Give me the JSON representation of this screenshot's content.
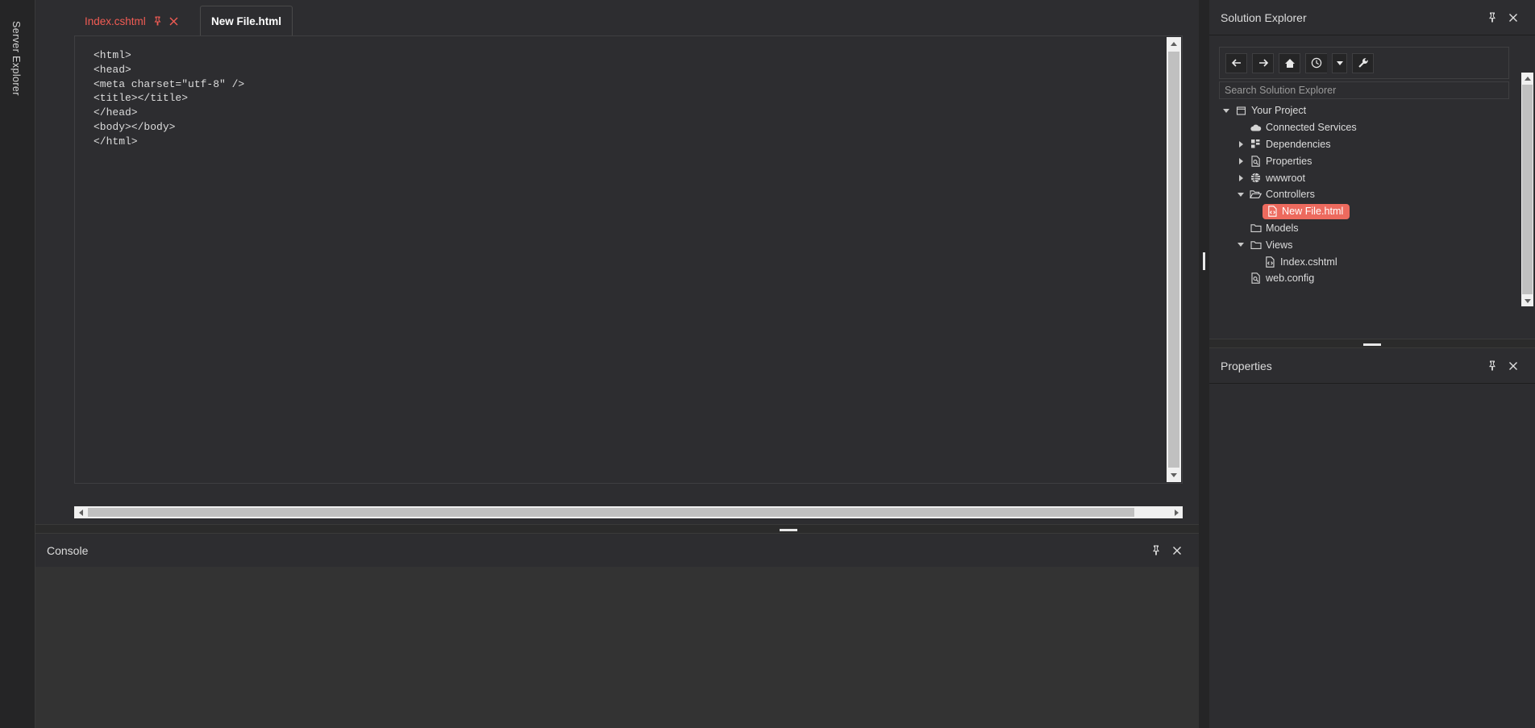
{
  "left_dock": {
    "label": "Server Explorer"
  },
  "editor": {
    "tabs": [
      {
        "title": "Index.cshtml",
        "active": false,
        "pin_icon": "pin-icon",
        "close_icon": "close-icon"
      },
      {
        "title": "New File.html",
        "active": true
      }
    ],
    "code": "<html>\n<head>\n<meta charset=\"utf-8\" />\n<title></title>\n</head>\n<body></body>\n</html>",
    "code_color": "#dcdcdc"
  },
  "solution_explorer": {
    "title": "Solution Explorer",
    "pin_label": "pin-icon",
    "close_label": "close-icon",
    "toolbar": [
      {
        "name": "back-button",
        "icon": "arrow-left-icon"
      },
      {
        "name": "forward-button",
        "icon": "arrow-right-icon"
      },
      {
        "name": "home-button",
        "icon": "home-icon"
      },
      {
        "name": "pending-changes-button",
        "icon": "clock-icon"
      },
      {
        "name": "pending-changes-dropdown",
        "icon": "chevron-down-icon"
      },
      {
        "name": "properties-button",
        "icon": "wrench-icon"
      }
    ],
    "search": {
      "placeholder": "Search Solution Explorer",
      "value": ""
    },
    "tree": [
      {
        "label": "Your Project",
        "depth": 0,
        "twisty": "down",
        "icon": "solution-icon",
        "selected": false
      },
      {
        "label": "Connected Services",
        "depth": 1,
        "twisty": "none",
        "icon": "cloud-icon",
        "selected": false
      },
      {
        "label": "Dependencies",
        "depth": 1,
        "twisty": "right",
        "icon": "packages-icon",
        "selected": false
      },
      {
        "label": "Properties",
        "depth": 1,
        "twisty": "right",
        "icon": "config-icon",
        "selected": false
      },
      {
        "label": "wwwroot",
        "depth": 1,
        "twisty": "right",
        "icon": "globe-icon",
        "selected": false
      },
      {
        "label": "Controllers",
        "depth": 1,
        "twisty": "down",
        "icon": "folder-open-icon",
        "selected": false
      },
      {
        "label": "New File.html",
        "depth": 2,
        "twisty": "none",
        "icon": "html-file-icon",
        "selected": true
      },
      {
        "label": "Models",
        "depth": 1,
        "twisty": "none",
        "icon": "folder-icon",
        "selected": false
      },
      {
        "label": "Views",
        "depth": 1,
        "twisty": "down",
        "icon": "folder-icon",
        "selected": false
      },
      {
        "label": "Index.cshtml",
        "depth": 2,
        "twisty": "none",
        "icon": "html-file-icon",
        "selected": false
      },
      {
        "label": "web.config",
        "depth": 1,
        "twisty": "none",
        "icon": "config-icon",
        "selected": false
      }
    ],
    "selection_color": "#ed6a5e"
  },
  "properties_panel": {
    "title": "Properties",
    "pin_label": "pin-icon",
    "close_label": "close-icon",
    "content": ""
  },
  "console_panel": {
    "title": "Console",
    "pin_label": "pin-icon",
    "close_label": "close-icon",
    "content": ""
  },
  "theme": {
    "background": "#252526",
    "panel_background": "#2d2d30",
    "accent_red": "#f25c54",
    "text": "#dcdcdc",
    "scrollbar_track": "#f0f0f0",
    "scrollbar_thumb": "#c0c0c0"
  }
}
